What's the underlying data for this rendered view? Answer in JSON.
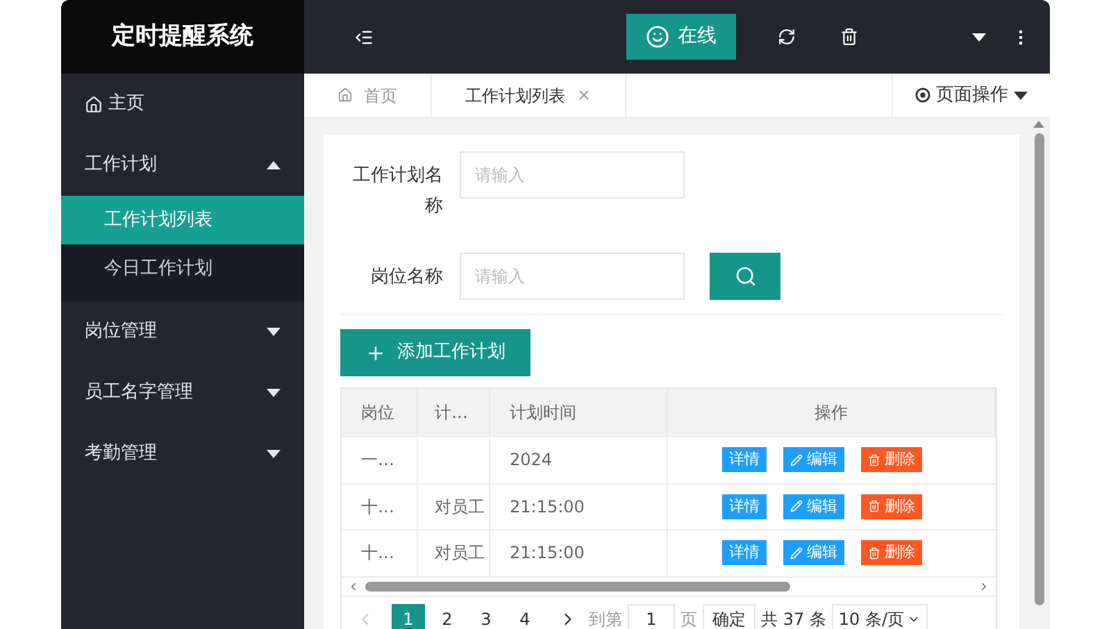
{
  "app_title": "定时提醒系统",
  "header": {
    "status_button": "在线"
  },
  "sidebar": {
    "items": [
      {
        "label": "主页",
        "kind": "home",
        "selected": false
      },
      {
        "label": "工作计划",
        "kind": "group",
        "expanded": true,
        "selected": false,
        "children": [
          {
            "label": "工作计划列表",
            "selected": true
          },
          {
            "label": "今日工作计划",
            "selected": false
          }
        ]
      },
      {
        "label": "岗位管理",
        "kind": "group",
        "expanded": false,
        "selected": false
      },
      {
        "label": "员工名字管理",
        "kind": "group",
        "expanded": false,
        "selected": false
      },
      {
        "label": "考勤管理",
        "kind": "group",
        "expanded": false,
        "selected": false
      }
    ]
  },
  "tabs": [
    {
      "label": "首页",
      "selected": false,
      "closable": false
    },
    {
      "label": "工作计划列表",
      "selected": true,
      "closable": true
    }
  ],
  "page_actions": "页面操作",
  "form": {
    "fields": [
      {
        "label": "工作计划名称",
        "placeholder": "请输入"
      },
      {
        "label": "岗位名称",
        "placeholder": "请输入"
      }
    ]
  },
  "add_button": "添加工作计划",
  "table": {
    "columns": [
      "岗位",
      "计…",
      "计划时间",
      "操作"
    ],
    "rows": [
      {
        "cells": [
          "一…",
          "",
          "2024"
        ],
        "actions": [
          "详情",
          "编辑",
          "删除"
        ]
      },
      {
        "cells": [
          "十…",
          "对员工",
          "21:15:00"
        ],
        "actions": [
          "详情",
          "编辑",
          "删除"
        ]
      },
      {
        "cells": [
          "十…",
          "对员工",
          "21:15:00"
        ],
        "actions": [
          "详情",
          "编辑",
          "删除"
        ]
      }
    ]
  },
  "pagination": {
    "pages": [
      {
        "label": "1",
        "selected": true
      },
      {
        "label": "2",
        "selected": false
      },
      {
        "label": "3",
        "selected": false
      },
      {
        "label": "4",
        "selected": false
      }
    ],
    "goto_label": "到第",
    "goto_value": "1",
    "page_unit": "页",
    "confirm": "确定",
    "total": "共 37 条",
    "page_size": "10 条/页"
  }
}
